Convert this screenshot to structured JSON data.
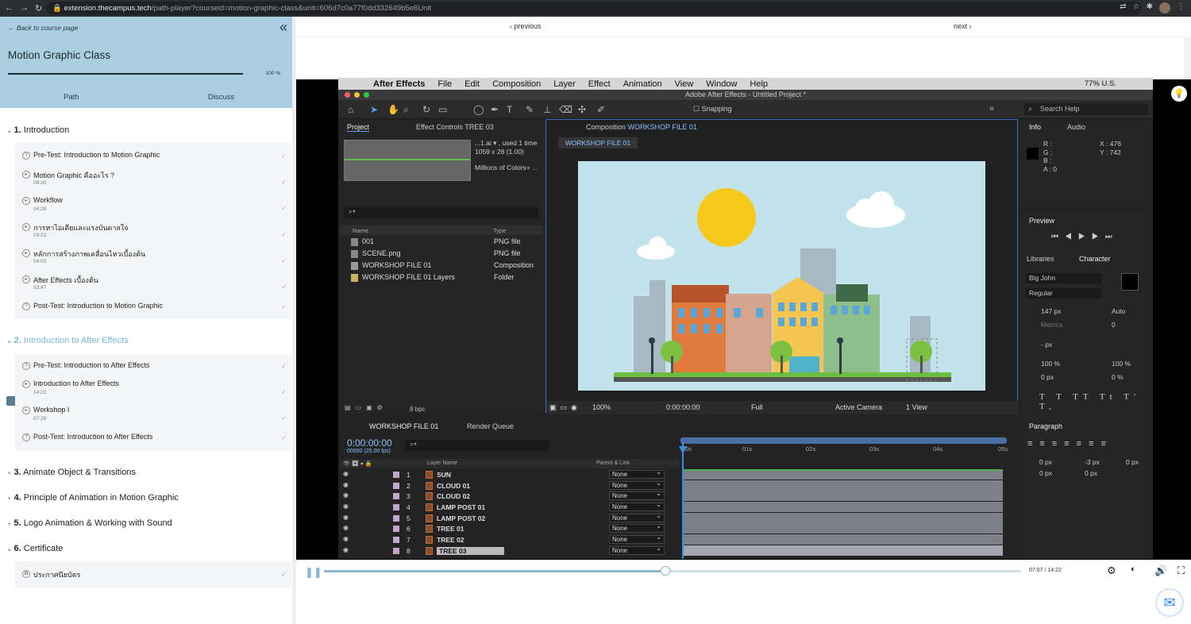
{
  "browser": {
    "url_domain": "extension.thecampus.tech",
    "url_path": "/path-player?courseid=motion-graphic-class&unit=606d7c0a77f0dd332649b5e6Unit"
  },
  "sidebar": {
    "back_label": "Back to course page",
    "course_title": "Motion Graphic Class",
    "progress_text": "100 %",
    "progress": 1.0,
    "tabs": [
      "Path",
      "Discuss"
    ],
    "sections": [
      {
        "num": "1.",
        "title": "Introduction",
        "lessons": [
          {
            "title": "Pre-Test: Introduction to Motion Graphic",
            "duration": ""
          },
          {
            "title": "Motion Graphic คืออะไร ?",
            "duration": "09:30"
          },
          {
            "title": "Workflow",
            "duration": "04:28"
          },
          {
            "title": "การหาไอเดียและแรงบันดาลใจ",
            "duration": "03:23"
          },
          {
            "title": "หลักการสร้างภาพเคลื่อนไหวเบื้องต้น",
            "duration": "04:03"
          },
          {
            "title": "After Effects เบื้องต้น",
            "duration": "03:47"
          },
          {
            "title": "Post-Test: Introduction to Motion Graphic",
            "duration": ""
          }
        ]
      },
      {
        "num": "2.",
        "title": "Introduction to After Effects",
        "lessons": [
          {
            "title": "Pre-Test: Introduction to After Effects",
            "duration": ""
          },
          {
            "title": "Introduction to After Effects",
            "duration": "14:22"
          },
          {
            "title": "Workshop I",
            "duration": "07:25"
          },
          {
            "title": "Post-Test: Introduction to After Effects",
            "duration": ""
          }
        ]
      },
      {
        "num": "3.",
        "title": "Animate Object & Transitions",
        "lessons": []
      },
      {
        "num": "4.",
        "title": "Principle of Animation in Motion Graphic",
        "lessons": []
      },
      {
        "num": "5.",
        "title": "Logo Animation & Working with Sound",
        "lessons": []
      },
      {
        "num": "6.",
        "title": "Certificate",
        "lessons": [
          {
            "title": "ประกาศนียบัตร",
            "duration": ""
          }
        ]
      }
    ]
  },
  "player_nav": {
    "prev": "‹ previous",
    "next": "next ›"
  },
  "ae": {
    "mac_menu": [
      "After Effects",
      "File",
      "Edit",
      "Composition",
      "Layer",
      "Effect",
      "Animation",
      "View",
      "Window",
      "Help"
    ],
    "mac_status": "77%  U.S.",
    "title": "Adobe After Effects - Untitled Project *",
    "snapping": "Snapping",
    "search_help": "Search Help",
    "project_tab": "Project",
    "effect_tab": "Effect Controls TREE 03",
    "proj_meta": [
      "...1.ai ▾ , used 1 time",
      "1059 x 28 (1.00)",
      "Millions of Colors+ ..."
    ],
    "proj_cols": [
      "Name",
      "Type"
    ],
    "proj_items": [
      {
        "name": "001",
        "type": "PNG file"
      },
      {
        "name": "SCENE.png",
        "type": "PNG file"
      },
      {
        "name": "WORKSHOP FILE 01",
        "type": "Composition"
      },
      {
        "name": "WORKSHOP FILE 01 Layers",
        "type": "Folder"
      }
    ],
    "bpc": "8 bpc",
    "comp_tab_prefix": "Composition",
    "comp_name": "WORKSHOP FILE 01",
    "comp_bar": {
      "zoom": "100%",
      "time": "0:00:00:00",
      "res": "Full",
      "camera": "Active Camera",
      "view": "1 View"
    },
    "info": {
      "tabs": [
        "Info",
        "Audio"
      ],
      "rgb": "R :\nG :\nB :\nA : 0",
      "x": "X : 476",
      "y": "Y : 742"
    },
    "preview_tab": "Preview",
    "char": {
      "tabs": [
        "Libraries",
        "Character"
      ],
      "font": "Big John",
      "style": "Regular",
      "size": "147 px",
      "leading": "Auto",
      "kerning": "Metrics",
      "tracking": "0",
      "stroke": "- px",
      "vscale": "100 %",
      "hscale": "100 %",
      "baseline": "0 px",
      "tsume": "0 %"
    },
    "para": {
      "tab": "Paragraph",
      "v1": "0 px",
      "v2": "-3 px",
      "v3": "0 px",
      "v4": "0 px",
      "v5": "0 px"
    },
    "timeline": {
      "tab": "WORKSHOP FILE 01",
      "render_queue": "Render Queue",
      "time": "0:00:00:00",
      "fps": "00000 (25.00 fps)",
      "head": {
        "layer": "Layer Name",
        "parent": "Parent & Link"
      },
      "ruler": [
        "0s",
        "01s",
        "02s",
        "03s",
        "04s",
        "05s"
      ],
      "layers": [
        {
          "num": "1",
          "name": "SUN",
          "parent": "None"
        },
        {
          "num": "2",
          "name": "CLOUD 01",
          "parent": "None"
        },
        {
          "num": "3",
          "name": "CLOUD 02",
          "parent": "None"
        },
        {
          "num": "4",
          "name": "LAMP POST 01",
          "parent": "None"
        },
        {
          "num": "5",
          "name": "LAMP POST 02",
          "parent": "None"
        },
        {
          "num": "6",
          "name": "TREE 01",
          "parent": "None"
        },
        {
          "num": "7",
          "name": "TREE 02",
          "parent": "None"
        },
        {
          "num": "8",
          "name": "TREE 03",
          "parent": "None"
        }
      ]
    }
  },
  "player": {
    "timecode": "07:07 / 14:22",
    "progress": 0.49
  }
}
